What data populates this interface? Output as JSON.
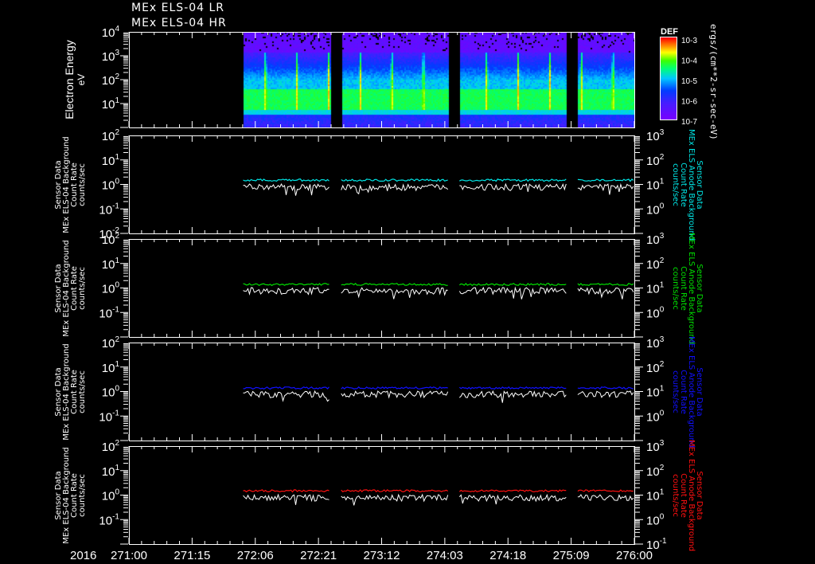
{
  "titles": [
    "MEx ELS-04 LR",
    "MEx ELS-04 HR"
  ],
  "year_label": "2016",
  "colors": {
    "cyan": "#00e5e5",
    "green": "#00dd00",
    "blue": "#1010ff",
    "red": "#ff1010",
    "white": "#ffffff"
  },
  "chart_data": [
    {
      "type": "heatmap",
      "title": "MEx ELS-04 LR / HR",
      "ylabel": "Electron Energy",
      "yunits": "eV",
      "yscale": "log",
      "ylim": [
        2,
        10000
      ],
      "yticks": [
        "10^1",
        "10^2",
        "10^3",
        "10^4"
      ],
      "xlim_day": [
        271.0,
        276.0
      ],
      "data_segments_day": [
        [
          272.13,
          272.99
        ],
        [
          273.1,
          274.16
        ],
        [
          274.27,
          275.33
        ],
        [
          275.44,
          276.0
        ]
      ],
      "colorbar": {
        "label": "DEF",
        "units": "ergs/(cm**2-sr-sec-eV)",
        "ticks": [
          "10^-3",
          "10^-4",
          "10^-5",
          "10^-6",
          "10^-7"
        ],
        "range": [
          1e-07,
          0.001
        ]
      },
      "features": {
        "peak_energy_band_eV": [
          5,
          30
        ],
        "spike_period_hours": 7.5
      }
    },
    {
      "type": "line",
      "panel": "cyan",
      "left_axis": {
        "label": [
          "Sensor Data",
          "MEx ELS-04 Background",
          "Count Rate",
          "counts/sec"
        ],
        "ylim": [
          0.01,
          100
        ],
        "yticks": [
          "10^-1",
          "10^0",
          "10^1",
          "10^2"
        ]
      },
      "right_axis": {
        "label": [
          "Sensor Data",
          "MEx ELS Anode Background",
          "Count Rate",
          "counts/sec"
        ],
        "ylim": [
          0.1,
          1000
        ],
        "yticks": [
          "10^0",
          "10^1",
          "10^2",
          "10^3"
        ]
      },
      "series": [
        {
          "name": "ELS-04 Background",
          "color": "white",
          "typical": 0.8
        },
        {
          "name": "Anode Background",
          "color": "cyan",
          "typical_right": 15
        }
      ]
    },
    {
      "type": "line",
      "panel": "green",
      "left_axis": {
        "label": [
          "Sensor Data",
          "MEx ELS-04 Background",
          "Count Rate",
          "counts/sec"
        ],
        "ylim": [
          0.01,
          100
        ],
        "yticks": [
          "10^-1",
          "10^0",
          "10^1",
          "10^2"
        ]
      },
      "right_axis": {
        "label": [
          "Sensor Data",
          "MEx ELS Anode Background",
          "Count Rate",
          "counts/sec"
        ],
        "ylim": [
          0.1,
          1000
        ],
        "yticks": [
          "10^0",
          "10^1",
          "10^2",
          "10^3"
        ]
      },
      "series": [
        {
          "name": "ELS-04 Background",
          "color": "white",
          "typical": 0.8
        },
        {
          "name": "Anode Background",
          "color": "green",
          "typical_right": 14
        }
      ]
    },
    {
      "type": "line",
      "panel": "blue",
      "left_axis": {
        "label": [
          "Sensor Data",
          "MEx ELS-04 Background",
          "Count Rate",
          "counts/sec"
        ],
        "ylim": [
          0.01,
          100
        ],
        "yticks": [
          "10^-1",
          "10^0",
          "10^1",
          "10^2"
        ]
      },
      "right_axis": {
        "label": [
          "Sensor Data",
          "MEx ELS Anode Background",
          "Count Rate",
          "counts/sec"
        ],
        "ylim": [
          0.1,
          1000
        ],
        "yticks": [
          "10^0",
          "10^1",
          "10^2",
          "10^3"
        ]
      },
      "series": [
        {
          "name": "ELS-04 Background",
          "color": "white",
          "typical": 0.8
        },
        {
          "name": "Anode Background",
          "color": "blue",
          "typical_right": 14
        }
      ]
    },
    {
      "type": "line",
      "panel": "red",
      "left_axis": {
        "label": [
          "Sensor Data",
          "MEx ELS-04 Background",
          "Count Rate",
          "counts/sec"
        ],
        "ylim": [
          0.01,
          100
        ],
        "yticks": [
          "10^-1",
          "10^0",
          "10^1",
          "10^2"
        ]
      },
      "right_axis": {
        "label": [
          "Sensor Data",
          "MEx ELS Anode Background",
          "Count Rate",
          "counts/sec"
        ],
        "ylim": [
          0.1,
          1000
        ],
        "yticks": [
          "10^0",
          "10^1",
          "10^2",
          "10^3"
        ]
      },
      "series": [
        {
          "name": "ELS-04 Background",
          "color": "white",
          "typical": 0.8
        },
        {
          "name": "Anode Background",
          "color": "red",
          "typical_right": 15
        }
      ]
    }
  ],
  "xaxis": {
    "tick_labels": [
      "271:00",
      "271:15",
      "272:06",
      "272:21",
      "273:12",
      "274:03",
      "274:18",
      "275:09",
      "276:00"
    ]
  }
}
